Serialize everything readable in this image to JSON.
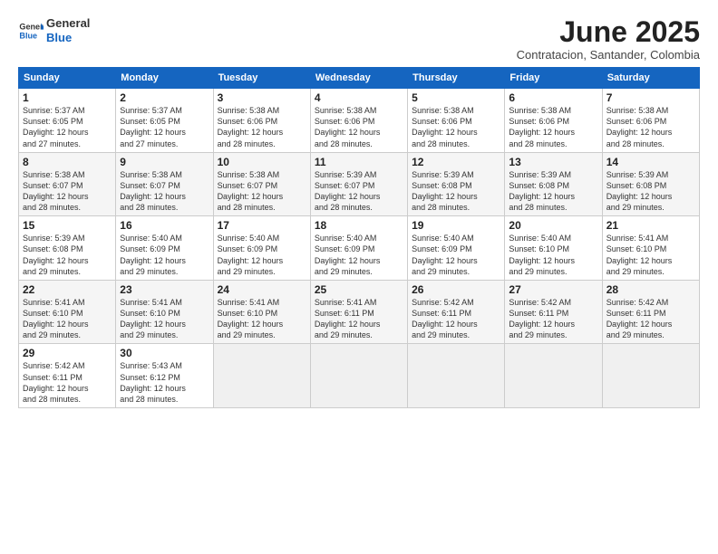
{
  "header": {
    "logo_general": "General",
    "logo_blue": "Blue",
    "title": "June 2025",
    "subtitle": "Contratacion, Santander, Colombia"
  },
  "days_of_week": [
    "Sunday",
    "Monday",
    "Tuesday",
    "Wednesday",
    "Thursday",
    "Friday",
    "Saturday"
  ],
  "weeks": [
    [
      {
        "day": "1",
        "info": "Sunrise: 5:37 AM\nSunset: 6:05 PM\nDaylight: 12 hours\nand 27 minutes."
      },
      {
        "day": "2",
        "info": "Sunrise: 5:37 AM\nSunset: 6:05 PM\nDaylight: 12 hours\nand 27 minutes."
      },
      {
        "day": "3",
        "info": "Sunrise: 5:38 AM\nSunset: 6:06 PM\nDaylight: 12 hours\nand 28 minutes."
      },
      {
        "day": "4",
        "info": "Sunrise: 5:38 AM\nSunset: 6:06 PM\nDaylight: 12 hours\nand 28 minutes."
      },
      {
        "day": "5",
        "info": "Sunrise: 5:38 AM\nSunset: 6:06 PM\nDaylight: 12 hours\nand 28 minutes."
      },
      {
        "day": "6",
        "info": "Sunrise: 5:38 AM\nSunset: 6:06 PM\nDaylight: 12 hours\nand 28 minutes."
      },
      {
        "day": "7",
        "info": "Sunrise: 5:38 AM\nSunset: 6:06 PM\nDaylight: 12 hours\nand 28 minutes."
      }
    ],
    [
      {
        "day": "8",
        "info": "Sunrise: 5:38 AM\nSunset: 6:07 PM\nDaylight: 12 hours\nand 28 minutes."
      },
      {
        "day": "9",
        "info": "Sunrise: 5:38 AM\nSunset: 6:07 PM\nDaylight: 12 hours\nand 28 minutes."
      },
      {
        "day": "10",
        "info": "Sunrise: 5:38 AM\nSunset: 6:07 PM\nDaylight: 12 hours\nand 28 minutes."
      },
      {
        "day": "11",
        "info": "Sunrise: 5:39 AM\nSunset: 6:07 PM\nDaylight: 12 hours\nand 28 minutes."
      },
      {
        "day": "12",
        "info": "Sunrise: 5:39 AM\nSunset: 6:08 PM\nDaylight: 12 hours\nand 28 minutes."
      },
      {
        "day": "13",
        "info": "Sunrise: 5:39 AM\nSunset: 6:08 PM\nDaylight: 12 hours\nand 28 minutes."
      },
      {
        "day": "14",
        "info": "Sunrise: 5:39 AM\nSunset: 6:08 PM\nDaylight: 12 hours\nand 29 minutes."
      }
    ],
    [
      {
        "day": "15",
        "info": "Sunrise: 5:39 AM\nSunset: 6:08 PM\nDaylight: 12 hours\nand 29 minutes."
      },
      {
        "day": "16",
        "info": "Sunrise: 5:40 AM\nSunset: 6:09 PM\nDaylight: 12 hours\nand 29 minutes."
      },
      {
        "day": "17",
        "info": "Sunrise: 5:40 AM\nSunset: 6:09 PM\nDaylight: 12 hours\nand 29 minutes."
      },
      {
        "day": "18",
        "info": "Sunrise: 5:40 AM\nSunset: 6:09 PM\nDaylight: 12 hours\nand 29 minutes."
      },
      {
        "day": "19",
        "info": "Sunrise: 5:40 AM\nSunset: 6:09 PM\nDaylight: 12 hours\nand 29 minutes."
      },
      {
        "day": "20",
        "info": "Sunrise: 5:40 AM\nSunset: 6:10 PM\nDaylight: 12 hours\nand 29 minutes."
      },
      {
        "day": "21",
        "info": "Sunrise: 5:41 AM\nSunset: 6:10 PM\nDaylight: 12 hours\nand 29 minutes."
      }
    ],
    [
      {
        "day": "22",
        "info": "Sunrise: 5:41 AM\nSunset: 6:10 PM\nDaylight: 12 hours\nand 29 minutes."
      },
      {
        "day": "23",
        "info": "Sunrise: 5:41 AM\nSunset: 6:10 PM\nDaylight: 12 hours\nand 29 minutes."
      },
      {
        "day": "24",
        "info": "Sunrise: 5:41 AM\nSunset: 6:10 PM\nDaylight: 12 hours\nand 29 minutes."
      },
      {
        "day": "25",
        "info": "Sunrise: 5:41 AM\nSunset: 6:11 PM\nDaylight: 12 hours\nand 29 minutes."
      },
      {
        "day": "26",
        "info": "Sunrise: 5:42 AM\nSunset: 6:11 PM\nDaylight: 12 hours\nand 29 minutes."
      },
      {
        "day": "27",
        "info": "Sunrise: 5:42 AM\nSunset: 6:11 PM\nDaylight: 12 hours\nand 29 minutes."
      },
      {
        "day": "28",
        "info": "Sunrise: 5:42 AM\nSunset: 6:11 PM\nDaylight: 12 hours\nand 29 minutes."
      }
    ],
    [
      {
        "day": "29",
        "info": "Sunrise: 5:42 AM\nSunset: 6:11 PM\nDaylight: 12 hours\nand 28 minutes."
      },
      {
        "day": "30",
        "info": "Sunrise: 5:43 AM\nSunset: 6:12 PM\nDaylight: 12 hours\nand 28 minutes."
      },
      {
        "day": "",
        "info": ""
      },
      {
        "day": "",
        "info": ""
      },
      {
        "day": "",
        "info": ""
      },
      {
        "day": "",
        "info": ""
      },
      {
        "day": "",
        "info": ""
      }
    ]
  ]
}
